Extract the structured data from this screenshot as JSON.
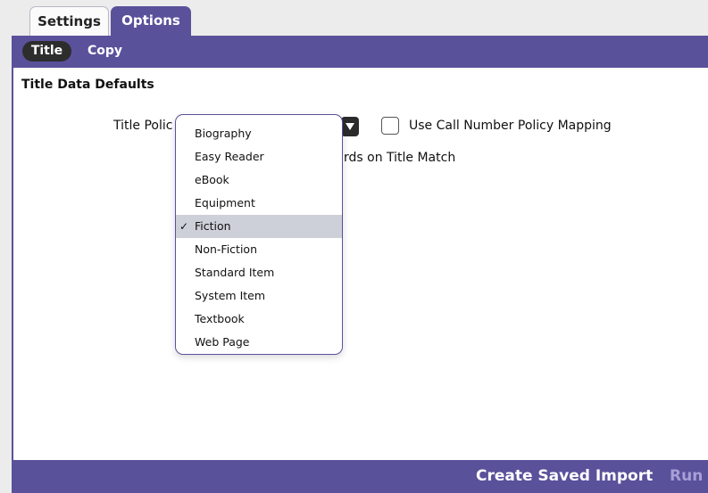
{
  "tabs": {
    "settings": "Settings",
    "options": "Options"
  },
  "subtabs": {
    "title": "Title",
    "copy": "Copy"
  },
  "content": {
    "section_title": "Title Data Defaults",
    "policy_label_visible": "Title Polic",
    "checkbox_label": "Use Call Number Policy Mapping",
    "partial_label": "rds on Title Match",
    "checkbox_checked": false
  },
  "dropdown": {
    "selected": "Fiction",
    "options": [
      "Biography",
      "Easy Reader",
      "eBook",
      "Equipment",
      "Fiction",
      "Non-Fiction",
      "Standard Item",
      "System Item",
      "Textbook",
      "Web Page"
    ]
  },
  "footer": {
    "create_saved_import": "Create Saved Import",
    "run": "Run"
  },
  "colors": {
    "accent": "#5a519b",
    "selected_row": "#cdd0d8"
  }
}
